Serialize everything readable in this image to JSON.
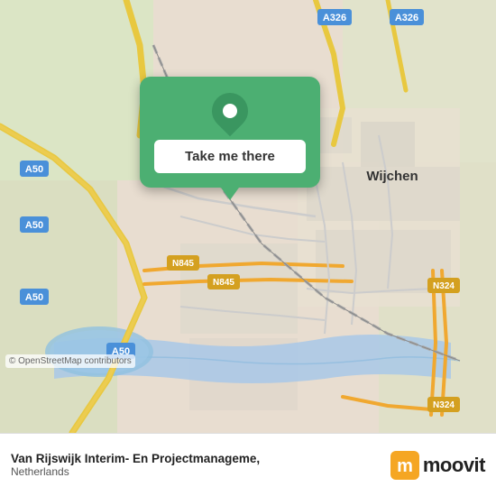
{
  "map": {
    "attribution": "© OpenStreetMap contributors",
    "background_color": "#e8e0d8"
  },
  "popup": {
    "button_label": "Take me there",
    "pin_color": "#3a9660",
    "card_color": "#4caf72"
  },
  "footer": {
    "company_name": "Van Rijswijk Interim- En Projectmanageme,",
    "company_country": "Netherlands",
    "moovit_label": "moovit"
  },
  "labels": {
    "wijchen": "Wijchen",
    "a50_1": "A50",
    "a50_2": "A50",
    "a50_3": "A50",
    "a50_4": "A50",
    "a326_1": "A326",
    "a326_2": "A326",
    "n845_1": "N845",
    "n845_2": "N845",
    "n324_1": "N324",
    "n324_2": "N324"
  }
}
